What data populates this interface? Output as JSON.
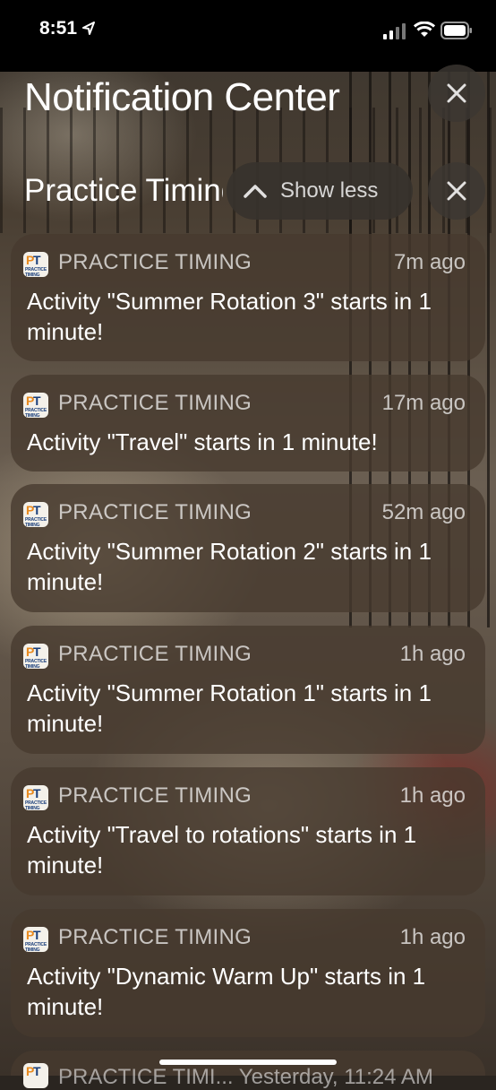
{
  "status_bar": {
    "time": "8:51"
  },
  "header": {
    "title": "Notification Center"
  },
  "group": {
    "title": "Practice Timing",
    "show_less_label": "Show less"
  },
  "app_icon": {
    "letters": "PT",
    "sub": "PRACTICE TIMING"
  },
  "notifications": [
    {
      "app": "PRACTICE TIMING",
      "age": "7m ago",
      "message": "Activity \"Summer Rotation 3\" starts in 1 minute!"
    },
    {
      "app": "PRACTICE TIMING",
      "age": "17m ago",
      "message": "Activity \"Travel\" starts in 1 minute!"
    },
    {
      "app": "PRACTICE TIMING",
      "age": "52m ago",
      "message": "Activity \"Summer Rotation 2\" starts in 1 minute!"
    },
    {
      "app": "PRACTICE TIMING",
      "age": "1h ago",
      "message": "Activity \"Summer Rotation 1\" starts in 1 minute!"
    },
    {
      "app": "PRACTICE TIMING",
      "age": "1h ago",
      "message": "Activity \"Travel to rotations\" starts in 1 minute!"
    },
    {
      "app": "PRACTICE TIMING",
      "age": "1h ago",
      "message": "Activity \"Dynamic Warm Up\" starts in 1 minute!"
    }
  ],
  "peek": {
    "text": "PRACTICE TIMI... Yesterday, 11:24 AM"
  },
  "icons": {
    "location": "location-arrow-icon",
    "signal": "cellular-signal-icon",
    "wifi": "wifi-icon",
    "battery": "battery-icon",
    "close": "close-icon",
    "chevron": "chevron-up-icon"
  }
}
